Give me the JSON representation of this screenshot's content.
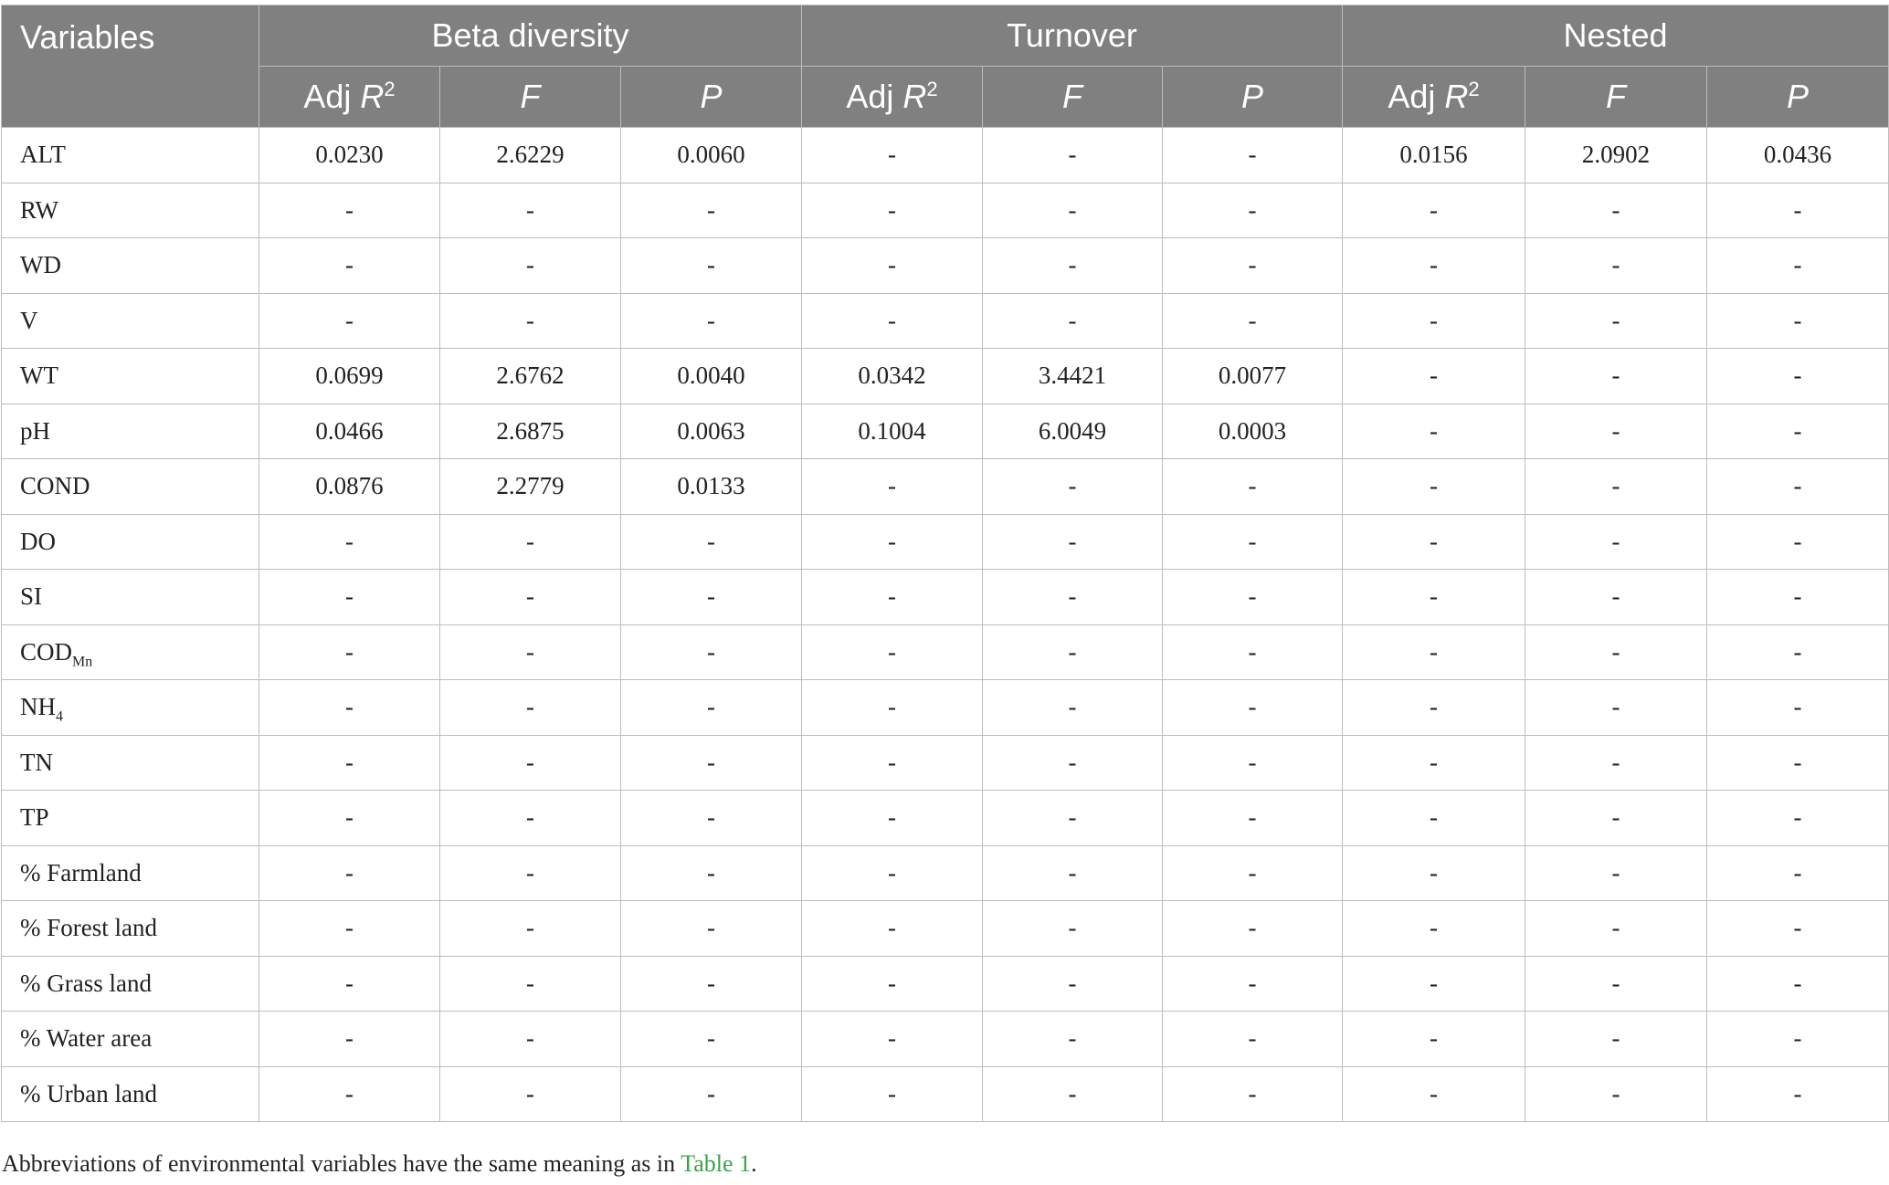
{
  "header": {
    "variables": "Variables",
    "groups": [
      "Beta diversity",
      "Turnover",
      "Nested"
    ],
    "sub": {
      "adj_prefix": "Adj ",
      "r_letter": "R",
      "r_sup": "2",
      "f": "F",
      "p": "P"
    }
  },
  "rows": [
    {
      "name": "ALT",
      "sub": "",
      "values": [
        "0.0230",
        "2.6229",
        "0.0060",
        "-",
        "-",
        "-",
        "0.0156",
        "2.0902",
        "0.0436"
      ]
    },
    {
      "name": "RW",
      "sub": "",
      "values": [
        "-",
        "-",
        "-",
        "-",
        "-",
        "-",
        "-",
        "-",
        "-"
      ]
    },
    {
      "name": "WD",
      "sub": "",
      "values": [
        "-",
        "-",
        "-",
        "-",
        "-",
        "-",
        "-",
        "-",
        "-"
      ]
    },
    {
      "name": "V",
      "sub": "",
      "values": [
        "-",
        "-",
        "-",
        "-",
        "-",
        "-",
        "-",
        "-",
        "-"
      ]
    },
    {
      "name": "WT",
      "sub": "",
      "values": [
        "0.0699",
        "2.6762",
        "0.0040",
        "0.0342",
        "3.4421",
        "0.0077",
        "-",
        "-",
        "-"
      ]
    },
    {
      "name": "pH",
      "sub": "",
      "values": [
        "0.0466",
        "2.6875",
        "0.0063",
        "0.1004",
        "6.0049",
        "0.0003",
        "-",
        "-",
        "-"
      ]
    },
    {
      "name": "COND",
      "sub": "",
      "values": [
        "0.0876",
        "2.2779",
        "0.0133",
        "-",
        "-",
        "-",
        "-",
        "-",
        "-"
      ]
    },
    {
      "name": "DO",
      "sub": "",
      "values": [
        "-",
        "-",
        "-",
        "-",
        "-",
        "-",
        "-",
        "-",
        "-"
      ]
    },
    {
      "name": "SI",
      "sub": "",
      "values": [
        "-",
        "-",
        "-",
        "-",
        "-",
        "-",
        "-",
        "-",
        "-"
      ]
    },
    {
      "name": "COD",
      "sub": "Mn",
      "values": [
        "-",
        "-",
        "-",
        "-",
        "-",
        "-",
        "-",
        "-",
        "-"
      ]
    },
    {
      "name": "NH",
      "sub": "4",
      "values": [
        "-",
        "-",
        "-",
        "-",
        "-",
        "-",
        "-",
        "-",
        "-"
      ]
    },
    {
      "name": "TN",
      "sub": "",
      "values": [
        "-",
        "-",
        "-",
        "-",
        "-",
        "-",
        "-",
        "-",
        "-"
      ]
    },
    {
      "name": "TP",
      "sub": "",
      "values": [
        "-",
        "-",
        "-",
        "-",
        "-",
        "-",
        "-",
        "-",
        "-"
      ]
    },
    {
      "name": "% Farmland",
      "sub": "",
      "values": [
        "-",
        "-",
        "-",
        "-",
        "-",
        "-",
        "-",
        "-",
        "-"
      ]
    },
    {
      "name": "% Forest land",
      "sub": "",
      "values": [
        "-",
        "-",
        "-",
        "-",
        "-",
        "-",
        "-",
        "-",
        "-"
      ]
    },
    {
      "name": "% Grass land",
      "sub": "",
      "values": [
        "-",
        "-",
        "-",
        "-",
        "-",
        "-",
        "-",
        "-",
        "-"
      ]
    },
    {
      "name": "% Water area",
      "sub": "",
      "values": [
        "-",
        "-",
        "-",
        "-",
        "-",
        "-",
        "-",
        "-",
        "-"
      ]
    },
    {
      "name": "% Urban land",
      "sub": "",
      "values": [
        "-",
        "-",
        "-",
        "-",
        "-",
        "-",
        "-",
        "-",
        "-"
      ]
    }
  ],
  "footnote": {
    "text": "Abbreviations of environmental variables have the same meaning as in ",
    "link": "Table 1",
    "end": "."
  },
  "colors": {
    "header_bg": "#808080",
    "header_text": "#ffffff",
    "grid": "#bdbdbd",
    "link": "#3aa14c"
  }
}
